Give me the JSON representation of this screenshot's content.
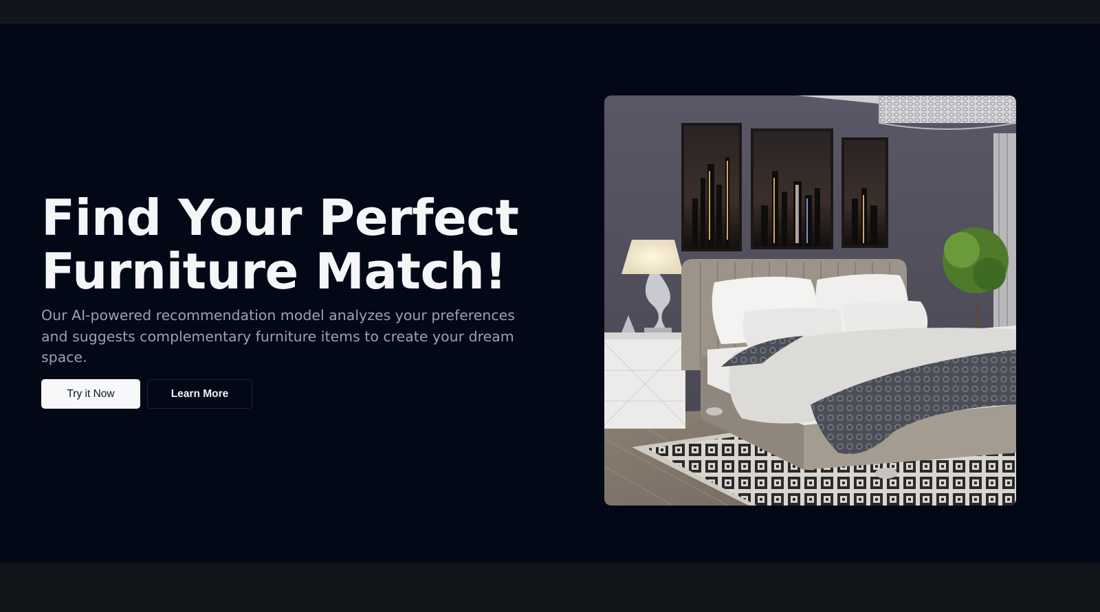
{
  "hero": {
    "headline_line1": "Find Your Perfect",
    "headline_line2": "Furniture Match!",
    "description": "Our AI-powered recommendation model analyzes your preferences and suggests complementary furniture items to create your dream space.",
    "primary_button_label": "Try it Now",
    "secondary_button_label": "Learn More",
    "image_subject": "bedroom with upholstered bed, lamp, nightstand, city-skyline triptych art, chandelier and potted plant"
  },
  "colors": {
    "background": "#030817",
    "chrome": "#111418",
    "headline": "#f5f6f8",
    "body_text": "#9aa3b2",
    "primary_button_bg": "#f7f8fa",
    "secondary_button_border": "#1e2533"
  }
}
